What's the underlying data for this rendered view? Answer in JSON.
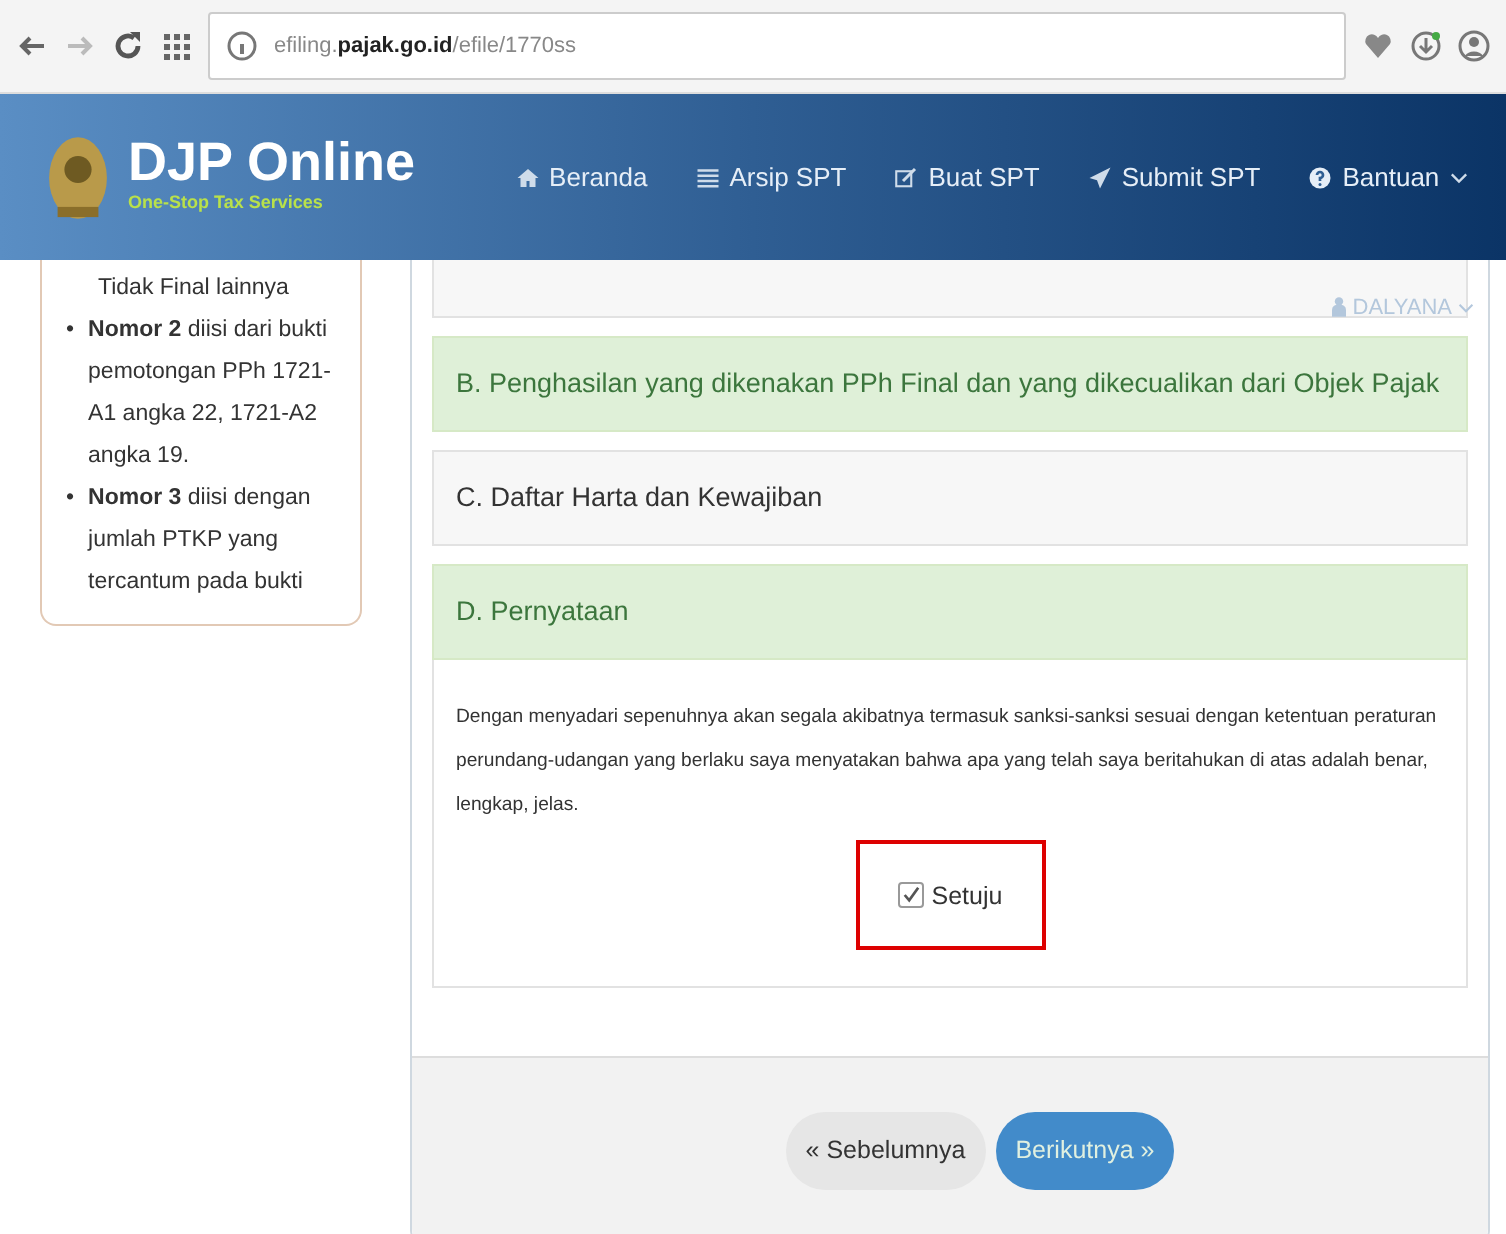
{
  "browser": {
    "url": "efiling.**pajak.go.id**/efile/1770ss"
  },
  "header": {
    "brand": "DJP Online",
    "tagline": "One-Stop Tax Services",
    "nav": [
      {
        "label": "Beranda",
        "dropdown": false
      },
      {
        "label": "Arsip SPT",
        "dropdown": false
      },
      {
        "label": "Buat SPT",
        "dropdown": false
      },
      {
        "label": "Submit SPT",
        "dropdown": false
      },
      {
        "label": "Bantuan",
        "dropdown": true
      }
    ],
    "user": "DALYANA"
  },
  "sidebar": {
    "lead": "Tidak Final lainnya",
    "items": [
      {
        "marker": "•",
        "text": "**Nomor 2** diisi dari bukti pemotongan PPh 1721-A1 angka 22, 1721-A2 angka 19."
      },
      {
        "marker": "•",
        "text": "**Nomor 3** diisi dengan jumlah PTKP yang tercantum pada bukti"
      }
    ]
  },
  "sections": [
    {
      "title": "B. Penghasilan yang dikenakan PPh Final dan yang dikecualikan dari Objek Pajak",
      "highlighted": true
    },
    {
      "title": "C. Daftar Harta dan Kewajiban",
      "highlighted": false
    },
    {
      "title": "D. Pernyataan",
      "highlighted": true
    }
  ],
  "statement": {
    "text": "Dengan menyadari sepenuhnya akan segala akibatnya termasuk sanksi-sanksi sesuai dengan ketentuan peraturan perundang-udangan yang berlaku saya menyatakan bahwa apa yang telah saya beritahukan di atas adalah benar, lengkap, jelas.",
    "agree_label": "Setuju",
    "checked": true
  },
  "buttons": [
    {
      "label": "« Sebelumnya",
      "kind": "secondary"
    },
    {
      "label": "Berikutnya »",
      "kind": "primary"
    }
  ]
}
